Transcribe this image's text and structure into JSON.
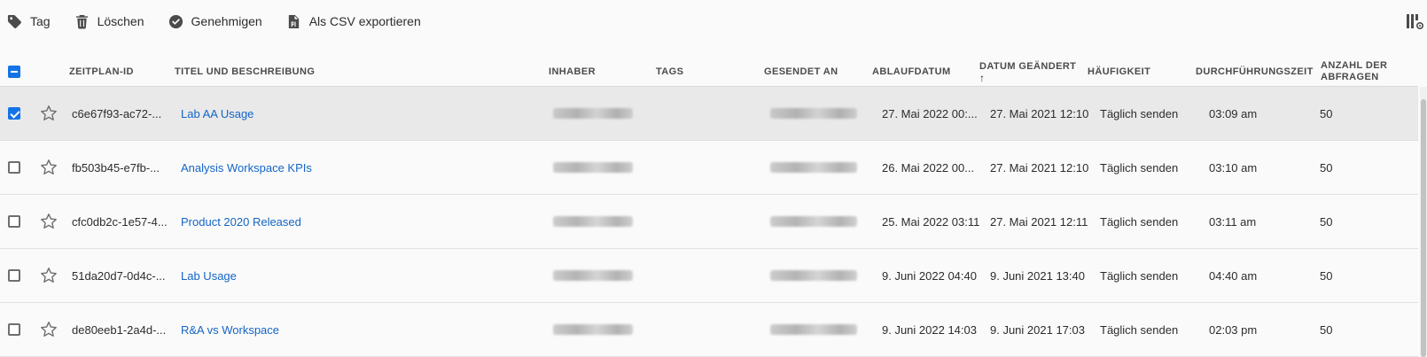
{
  "toolbar": {
    "tag_label": "Tag",
    "delete_label": "Löschen",
    "approve_label": "Genehmigen",
    "export_label": "Als CSV exportieren"
  },
  "columns": {
    "id": "ZEITPLAN-ID",
    "title": "TITEL UND BESCHREIBUNG",
    "owner": "INHABER",
    "tags": "TAGS",
    "sent_to": "GESENDET AN",
    "expiry": "ABLAUFDATUM",
    "modified": "DATUM GEÄNDERT",
    "modified_arrow": "↑",
    "frequency": "HÄUFIGKEIT",
    "run_time": "DURCHFÜHRUNGSZEIT",
    "queries_line1": "ANZAHL DER",
    "queries_line2": "ABFRAGEN"
  },
  "rows": [
    {
      "selected": true,
      "id": "c6e67f93-ac72-...",
      "title": "Lab AA Usage",
      "expiry": "27. Mai 2022 00:...",
      "modified": "27. Mai 2021 12:10",
      "frequency": "Täglich senden",
      "run_time": "03:09 am",
      "queries": "50"
    },
    {
      "selected": false,
      "id": "fb503b45-e7fb-...",
      "title": "Analysis Workspace KPIs",
      "expiry": "26. Mai 2022 00...",
      "modified": "27. Mai 2021 12:10",
      "frequency": "Täglich senden",
      "run_time": "03:10 am",
      "queries": "50"
    },
    {
      "selected": false,
      "id": "cfc0db2c-1e57-4...",
      "title": "Product  2020 Released",
      "expiry": "25. Mai 2022 03:11",
      "modified": "27. Mai 2021 12:11",
      "frequency": "Täglich senden",
      "run_time": "03:11 am",
      "queries": "50"
    },
    {
      "selected": false,
      "id": "51da20d7-0d4c-...",
      "title": "Lab Usage",
      "expiry": "9. Juni 2022 04:40",
      "modified": "9. Juni 2021 13:40",
      "frequency": "Täglich senden",
      "run_time": "04:40 am",
      "queries": "50"
    },
    {
      "selected": false,
      "id": "de80eeb1-2a4d-...",
      "title": "R&A vs Workspace",
      "expiry": "9. Juni 2022 14:03",
      "modified": "9. Juni 2021 17:03",
      "frequency": "Täglich senden",
      "run_time": "02:03 pm",
      "queries": "50"
    }
  ],
  "colors": {
    "accent": "#1473e6",
    "link": "#1465c7",
    "selected_row": "#e9e9e9"
  },
  "icons": [
    "tag-icon",
    "trash-icon",
    "checkmark-circle-icon",
    "file-csv-icon",
    "column-settings-icon",
    "star-outline-icon"
  ]
}
